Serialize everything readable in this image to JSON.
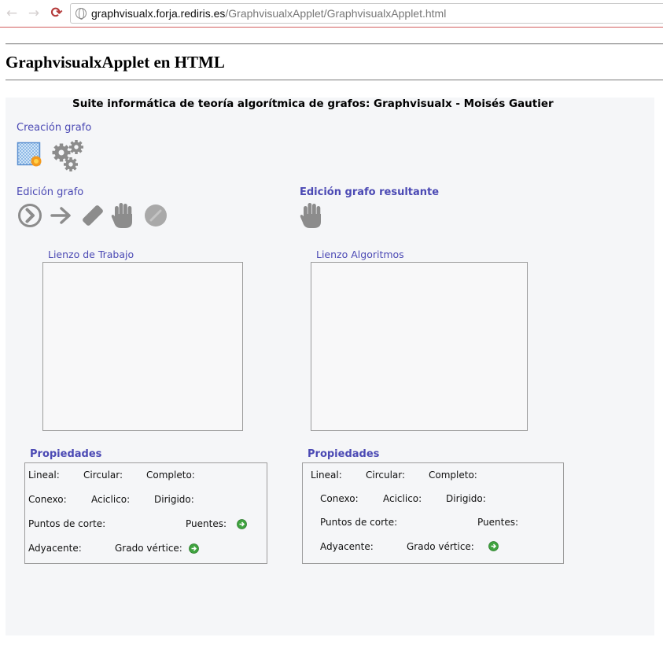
{
  "browser": {
    "back_icon": "back-arrow-icon",
    "forward_icon": "forward-arrow-icon",
    "reload_icon": "reload-icon",
    "url_host": "graphvisualx.forja.rediris.es",
    "url_path": "/GraphvisualxApplet/GraphvisualxApplet.html"
  },
  "page": {
    "title": "GraphvisualxApplet en HTML"
  },
  "applet": {
    "suite_title": "Suite informática de teoría algorítmica de grafos: Graphvisualx - Moisés Gautier",
    "creation_label": "Creación grafo",
    "edit_label": "Edición grafo",
    "result_edit_label": "Edición grafo resultante",
    "canvas_work_label": "Lienzo de Trabajo",
    "canvas_algo_label": "Lienzo Algoritmos",
    "props_left": {
      "title": "Propiedades",
      "lineal": "Lineal:",
      "circular": "Circular:",
      "completo": "Completo:",
      "conexo": "Conexo:",
      "aciclico": "Aciclico:",
      "dirigido": "Dirigido:",
      "puntos_corte": "Puntos de corte:",
      "puentes": "Puentes:",
      "adyacente": "Adyacente:",
      "grado_vertice": "Grado vértice:"
    },
    "props_right": {
      "title": "Propiedades",
      "lineal": "Lineal:",
      "circular": "Circular:",
      "completo": "Completo:",
      "conexo": "Conexo:",
      "aciclico": "Aciclico:",
      "dirigido": "Dirigido:",
      "puntos_corte": "Puntos de corte:",
      "puentes": "Puentes:",
      "adyacente": "Adyacente:",
      "grado_vertice": "Grado vértice:"
    }
  },
  "colors": {
    "accent": "#4b49b4",
    "icon_gray": "#8c8c8c",
    "go_green": "#3fa33f"
  }
}
